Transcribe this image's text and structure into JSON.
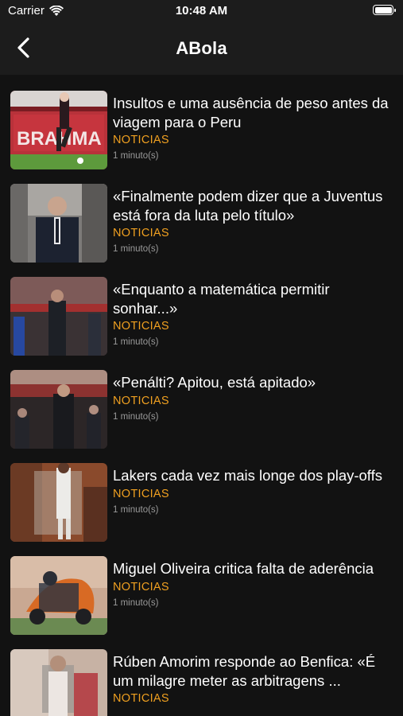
{
  "status": {
    "carrier": "Carrier",
    "time": "10:48 AM"
  },
  "nav": {
    "title": "ABola"
  },
  "articles": [
    {
      "title": "Insultos e uma ausência de peso antes da viagem para o Peru",
      "category": "NOTICIAS",
      "time": "1 minuto(s)"
    },
    {
      "title": "«Finalmente podem dizer que a Juventus está fora da luta pelo título»",
      "category": "NOTICIAS",
      "time": "1 minuto(s)"
    },
    {
      "title": "«Enquanto a matemática permitir sonhar...»",
      "category": "NOTICIAS",
      "time": "1 minuto(s)"
    },
    {
      "title": "«Penálti? Apitou, está apitado»",
      "category": "NOTICIAS",
      "time": "1 minuto(s)"
    },
    {
      "title": "Lakers cada vez mais longe dos play-offs",
      "category": "NOTICIAS",
      "time": "1 minuto(s)"
    },
    {
      "title": "Miguel Oliveira critica falta de aderência",
      "category": "NOTICIAS",
      "time": "1 minuto(s)"
    },
    {
      "title": "Rúben Amorim responde ao Benfica: «É um milagre meter as arbitragens ...",
      "category": "NOTICIAS",
      "time": ""
    }
  ],
  "colors": {
    "background": "#121212",
    "bar": "#1c1c1c",
    "category": "#f0a020",
    "time": "#9a9a9a"
  }
}
